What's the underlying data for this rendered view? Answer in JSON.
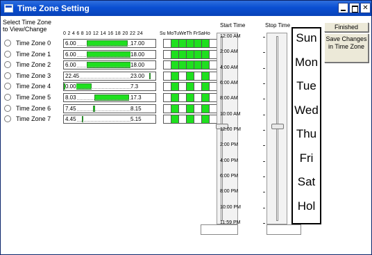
{
  "window": {
    "title": "Time Zone Setting",
    "buttons": {
      "minimize": "minimize",
      "maximize": "maximize",
      "close": "✕"
    }
  },
  "select_label": [
    "Select Time Zone",
    "to View/Change"
  ],
  "hour_scale": "0 2 4 6 8 10 12 14 16 18 20 22 24",
  "day_header": "Su MoTuWeTh FrSaHo",
  "time_zones": [
    {
      "label": "Time Zone 0",
      "start": "6.00",
      "stop": "17.00",
      "fill_from": 6,
      "fill_to": 17,
      "days": [
        0,
        1,
        1,
        1,
        1,
        1,
        0,
        0
      ]
    },
    {
      "label": "Time Zone 1",
      "start": "6.00",
      "stop": "18.00",
      "fill_from": 6,
      "fill_to": 18,
      "days": [
        0,
        1,
        1,
        1,
        1,
        1,
        0,
        0
      ]
    },
    {
      "label": "Time Zone 2",
      "start": "6.00",
      "stop": "18.00",
      "fill_from": 6,
      "fill_to": 18,
      "days": [
        0,
        1,
        1,
        1,
        1,
        1,
        0,
        0
      ]
    },
    {
      "label": "Time Zone 3",
      "start": "22.45",
      "stop": "23.00",
      "fill_from": 22.75,
      "fill_to": 23,
      "days": [
        0,
        1,
        0,
        1,
        0,
        1,
        0,
        0
      ]
    },
    {
      "label": "Time Zone 4",
      "start": "0.00",
      "stop": "7.3",
      "fill_from": 0,
      "fill_to": 7.3,
      "days": [
        0,
        1,
        0,
        1,
        0,
        1,
        0,
        0
      ]
    },
    {
      "label": "Time Zone 5",
      "start": "8.03",
      "stop": "17.3",
      "fill_from": 8.05,
      "fill_to": 17.3,
      "days": [
        0,
        1,
        0,
        1,
        0,
        1,
        0,
        0
      ]
    },
    {
      "label": "Time Zone 6",
      "start": "7.45",
      "stop": "8.15",
      "fill_from": 7.75,
      "fill_to": 8.25,
      "days": [
        0,
        1,
        0,
        1,
        0,
        1,
        0,
        0
      ]
    },
    {
      "label": "Time Zone 7",
      "start": "4.45",
      "stop": "5.15",
      "fill_from": 4.75,
      "fill_to": 5.25,
      "days": [
        0,
        1,
        0,
        1,
        0,
        1,
        0,
        0
      ]
    }
  ],
  "start_time": {
    "label": "Start Time",
    "ticks": [
      "12:00 AM",
      "2:00 AM",
      "4:00 AM",
      "6:00 AM",
      "8:00 AM",
      "10:00 AM",
      "12:00 PM",
      "2:00 PM",
      "4:00 PM",
      "6:00 PM",
      "8:00 PM",
      "10:00 PM",
      "11:59 PM"
    ],
    "value": ""
  },
  "stop_time": {
    "label": "Stop Time",
    "value": ""
  },
  "days_list": [
    "Sun",
    "Mon",
    "Tue",
    "Wed",
    "Thu",
    "Fri",
    "Sat",
    "Hol"
  ],
  "buttons": {
    "finished": "Finished",
    "save": "Save Changes in Time Zone"
  },
  "colors": {
    "active": "#1fe01f",
    "titlebar": "#0a4fd2"
  }
}
